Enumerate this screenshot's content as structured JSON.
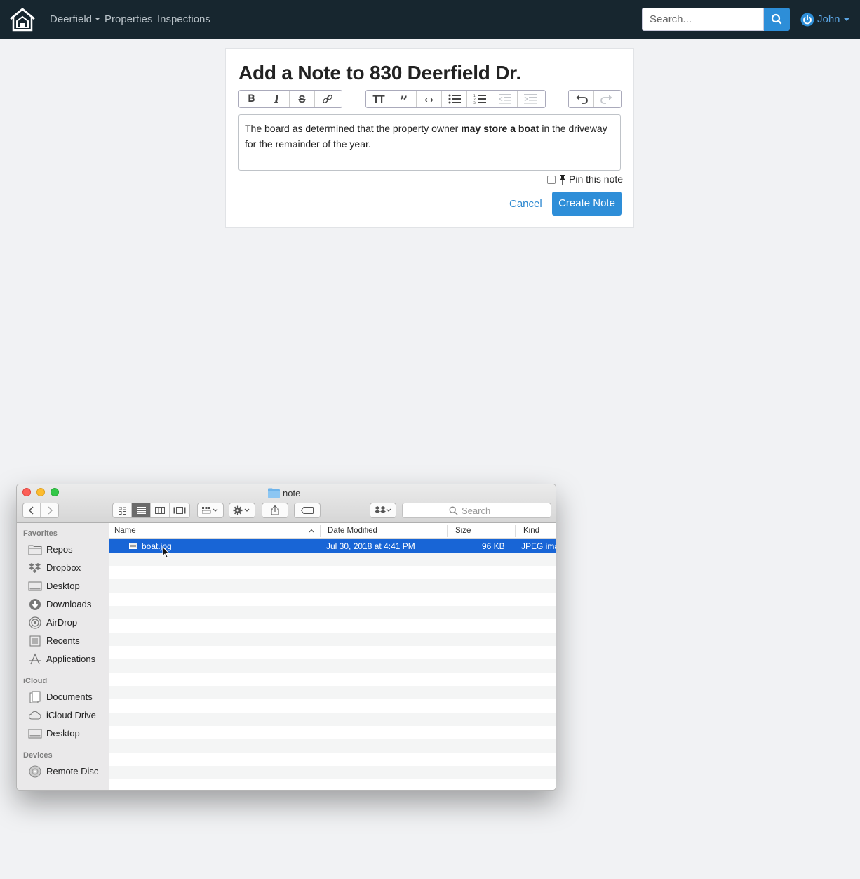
{
  "navbar": {
    "brand_menu": "Deerfield",
    "links": [
      "Properties",
      "Inspections"
    ],
    "search_placeholder": "Search...",
    "user": "John"
  },
  "note_form": {
    "title": "Add a Note to 830 Deerfield Dr.",
    "toolbar_groups": [
      [
        "bold-icon",
        "italic-icon",
        "strikethrough-icon",
        "link-icon"
      ],
      [
        "heading-icon",
        "quote-icon",
        "code-icon",
        "bullet-list-icon",
        "numbered-list-icon",
        "outdent-icon",
        "indent-icon"
      ],
      [
        "undo-icon",
        "redo-icon"
      ]
    ],
    "body_parts": {
      "before": "The board as determined that the property owner ",
      "bold": "may store a boat",
      "after": " in the driveway for the remainder of the year."
    },
    "pin_label": "Pin this note",
    "pinned": false,
    "cancel_label": "Cancel",
    "submit_label": "Create Note"
  },
  "finder": {
    "folder_name": "note",
    "search_placeholder": "Search",
    "sidebar": {
      "favorites_header": "Favorites",
      "favorites": [
        "Repos",
        "Dropbox",
        "Desktop",
        "Downloads",
        "AirDrop",
        "Recents",
        "Applications"
      ],
      "icloud_header": "iCloud",
      "icloud": [
        "Documents",
        "iCloud Drive",
        "Desktop"
      ],
      "devices_header": "Devices",
      "devices": [
        "Remote Disc"
      ]
    },
    "columns": [
      "Name",
      "Date Modified",
      "Size",
      "Kind"
    ],
    "files": [
      {
        "name": "boat.jpg",
        "modified": "Jul 30, 2018 at 4:41 PM",
        "size": "96 KB",
        "kind": "JPEG ima"
      }
    ],
    "selected_file": "boat.jpg"
  }
}
